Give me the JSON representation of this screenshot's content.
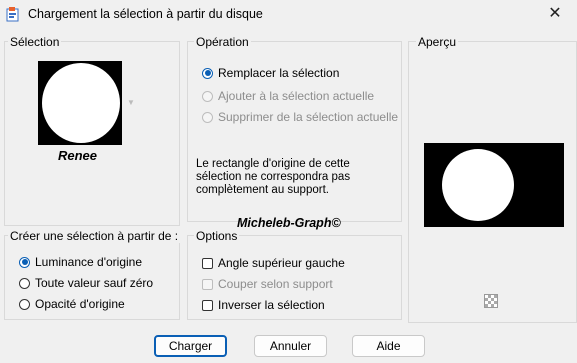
{
  "window": {
    "title": "Chargement la sélection à partir du disque",
    "close_glyph": "✕"
  },
  "selection": {
    "legend": "Sélection",
    "name": "Renee"
  },
  "operation": {
    "legend": "Opération",
    "options": [
      {
        "label": "Remplacer la sélection",
        "checked": true,
        "enabled": true
      },
      {
        "label": "Ajouter à la sélection actuelle",
        "checked": false,
        "enabled": false
      },
      {
        "label": "Supprimer de la sélection actuelle",
        "checked": false,
        "enabled": false
      }
    ],
    "note": "Le rectangle d'origine de cette sélection ne correspondra pas complètement au support."
  },
  "watermark": "Micheleb-Graph©",
  "preview": {
    "legend": "Aperçu"
  },
  "create_from": {
    "legend": "Créer une sélection à partir de :",
    "options": [
      {
        "label": "Luminance d'origine",
        "checked": true
      },
      {
        "label": "Toute valeur sauf zéro",
        "checked": false
      },
      {
        "label": "Opacité d'origine",
        "checked": false
      }
    ]
  },
  "options": {
    "legend": "Options",
    "items": [
      {
        "label": "Angle supérieur gauche",
        "checked": false,
        "enabled": true
      },
      {
        "label": "Couper selon support",
        "checked": false,
        "enabled": false
      },
      {
        "label": "Inverser la sélection",
        "checked": false,
        "enabled": true
      }
    ]
  },
  "buttons": {
    "load": "Charger",
    "cancel": "Annuler",
    "help": "Aide"
  },
  "colors": {
    "accent": "#0a5fb5",
    "background": "#f0f0f0"
  }
}
